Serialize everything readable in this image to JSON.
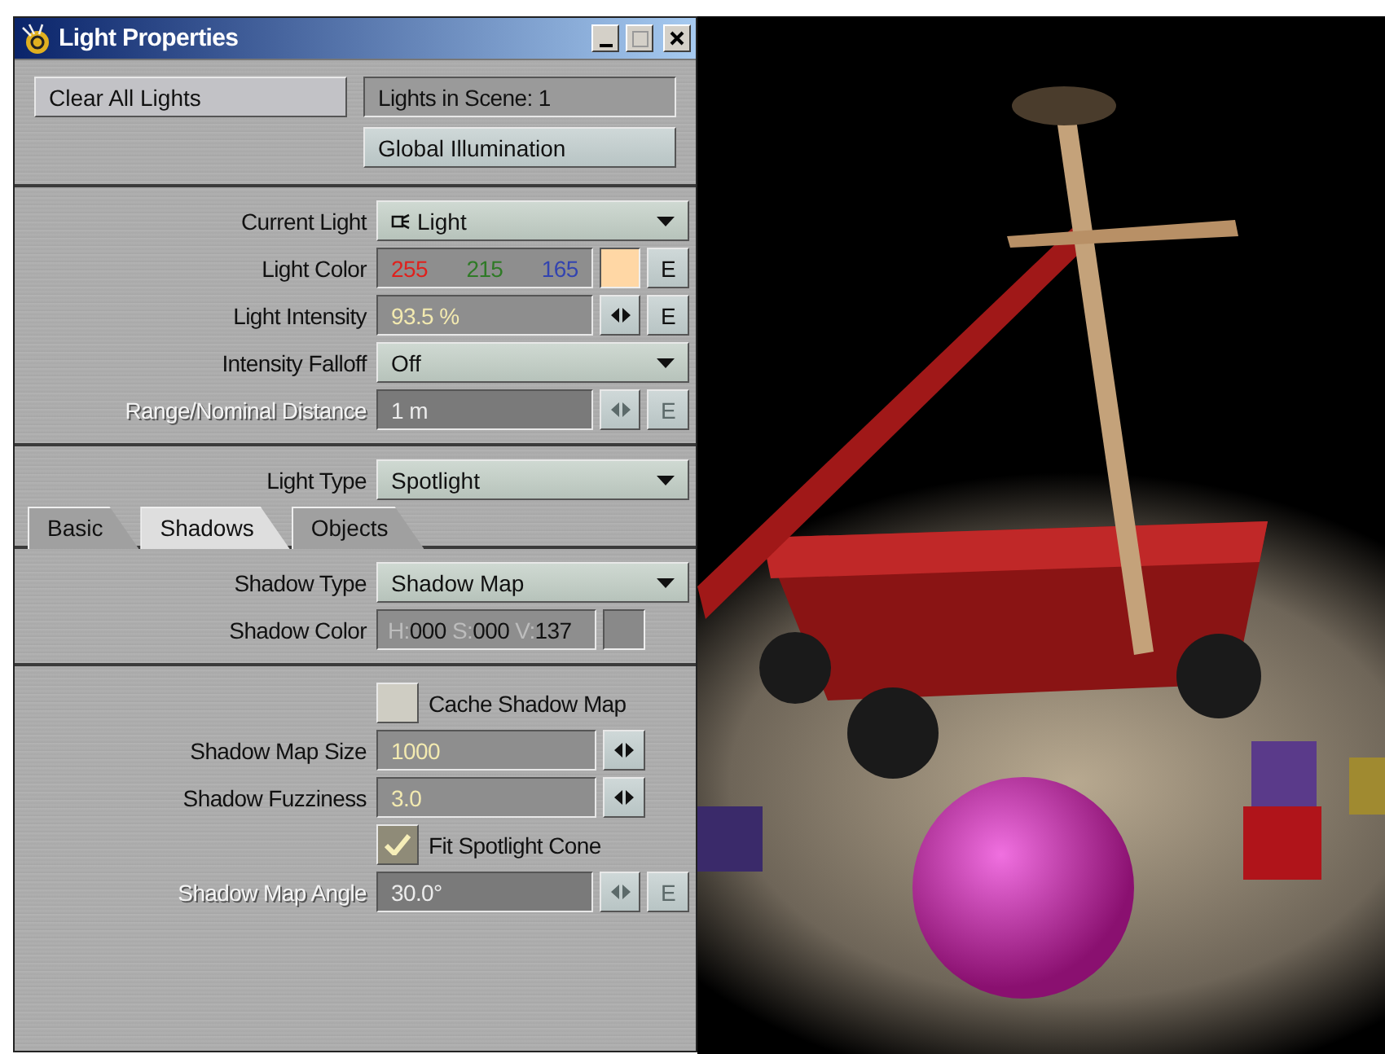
{
  "window": {
    "title": "Light Properties"
  },
  "top": {
    "clear_button": "Clear All Lights",
    "lights_in_scene": "Lights in Scene: 1",
    "global_illumination": "Global Illumination"
  },
  "light_rows": [
    {
      "kind": "dropdown",
      "label": "Current Light",
      "value": "Light",
      "icon": true,
      "disabled": false
    },
    {
      "kind": "rgb",
      "label": "Light Color",
      "red": "255",
      "green": "215",
      "blue": "165",
      "envelope": "E",
      "disabled": false
    },
    {
      "kind": "number",
      "label": "Light Intensity",
      "value": "93.5 %",
      "envelope": "E",
      "disabled": false
    },
    {
      "kind": "dropdown",
      "label": "Intensity Falloff",
      "value": "Off",
      "icon": false,
      "disabled": false
    },
    {
      "kind": "number",
      "label": "Range/Nominal Distance",
      "value": "1 m",
      "envelope": "E",
      "disabled": true
    }
  ],
  "type_rows": [
    {
      "kind": "dropdown",
      "label": "Light Type",
      "value": "Spotlight",
      "icon": false,
      "disabled": false
    }
  ],
  "tabs": [
    {
      "label": "Basic",
      "selected": false
    },
    {
      "label": "Shadows",
      "selected": true
    },
    {
      "label": "Objects",
      "selected": false
    }
  ],
  "shadow_rows": [
    {
      "kind": "dropdown",
      "label": "Shadow Type",
      "value": "Shadow Map",
      "icon": false,
      "disabled": false
    },
    {
      "kind": "hsv",
      "label": "Shadow Color",
      "h_label": "H:",
      "h": "000",
      "s_label": "S:",
      "s": "000",
      "v_label": "V:",
      "v": "137",
      "disabled": false
    }
  ],
  "option_rows": [
    {
      "kind": "checkbox",
      "label": "Cache Shadow Map",
      "checked": false,
      "disabled": false
    },
    {
      "kind": "number",
      "label": "Shadow Map Size",
      "value": "1000",
      "disabled": false
    },
    {
      "kind": "number",
      "label": "Shadow Fuzziness",
      "value": "3.0",
      "disabled": false
    },
    {
      "kind": "checkbox",
      "label": "Fit Spotlight Cone",
      "checked": true,
      "disabled": false
    },
    {
      "kind": "number",
      "label": "Shadow Map Angle",
      "value": "30.0°",
      "envelope": "E",
      "disabled": true
    }
  ]
}
